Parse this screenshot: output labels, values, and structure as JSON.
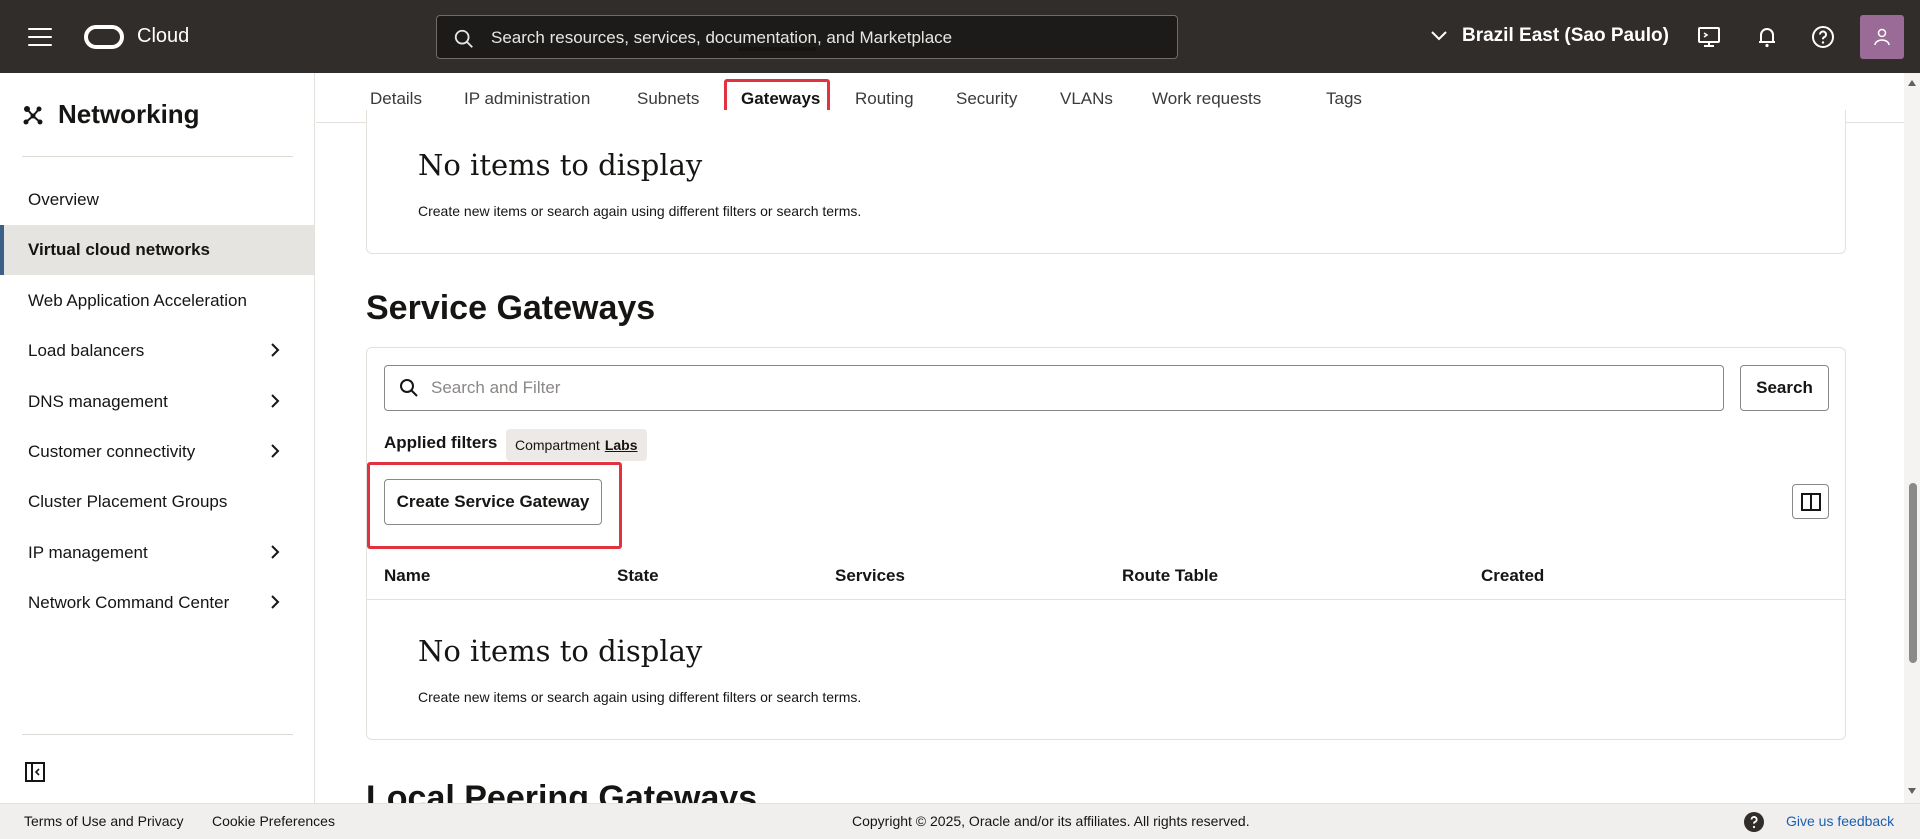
{
  "header": {
    "brand": "Cloud",
    "search_placeholder": "Search resources, services, documentation, and Marketplace",
    "region": "Brazil East (Sao Paulo)"
  },
  "sidebar": {
    "title": "Networking",
    "items": [
      {
        "label": "Overview"
      },
      {
        "label": "Virtual cloud networks"
      },
      {
        "label": "Web Application Acceleration"
      },
      {
        "label": "Load balancers"
      },
      {
        "label": "DNS management"
      },
      {
        "label": "Customer connectivity"
      },
      {
        "label": "Cluster Placement Groups"
      },
      {
        "label": "IP management"
      },
      {
        "label": "Network Command Center"
      }
    ]
  },
  "tabs": [
    "Details",
    "IP administration",
    "Subnets",
    "Gateways",
    "Routing",
    "Security",
    "VLANs",
    "Work requests",
    "Tags"
  ],
  "top_card": {
    "empty_title": "No items to display",
    "empty_sub": "Create new items or search again using different filters or search terms."
  },
  "service_gateways": {
    "title": "Service Gateways",
    "filter_placeholder": "Search and Filter",
    "search_button": "Search",
    "applied_filters_label": "Applied filters",
    "chip_label": "Compartment",
    "chip_value": "Labs",
    "create_button": "Create Service Gateway",
    "columns": [
      "Name",
      "State",
      "Services",
      "Route Table",
      "Created"
    ],
    "empty_title": "No items to display",
    "empty_sub": "Create new items or search again using different filters or search terms."
  },
  "next_section_title": "Local Peering Gateways",
  "footer": {
    "terms": "Terms of Use and Privacy",
    "cookies": "Cookie Preferences",
    "copyright": "Copyright © 2025, Oracle and/or its affiliates. All rights reserved.",
    "feedback": "Give us feedback"
  },
  "colors": {
    "header_bg": "#312d2a",
    "highlight": "#e0333d",
    "active_accent": "#3b5f86"
  }
}
